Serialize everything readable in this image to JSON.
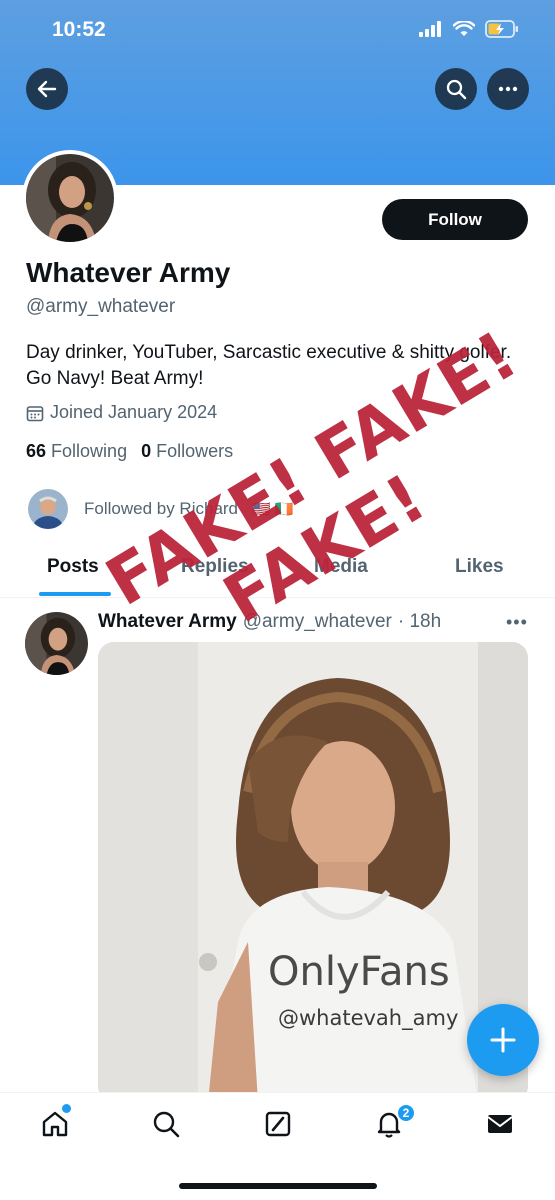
{
  "status_bar": {
    "time": "10:52"
  },
  "profile": {
    "name": "Whatever Army",
    "handle": "@army_whatever",
    "bio": "Day drinker, YouTuber, Sarcastic executive & shitty golfer. Go Navy! Beat Army!",
    "joined": "Joined January 2024",
    "following_count": "66",
    "following_label": "Following",
    "followers_count": "0",
    "followers_label": "Followers",
    "followed_by": "Followed by Richard",
    "followed_by_flags": "🇺🇸 🇮🇪",
    "follow_button": "Follow"
  },
  "tabs": [
    {
      "label": "Posts",
      "active": true
    },
    {
      "label": "Replies",
      "active": false
    },
    {
      "label": "Media",
      "active": false
    },
    {
      "label": "Likes",
      "active": false
    }
  ],
  "post": {
    "author_name": "Whatever Army",
    "author_handle": "@army_whatever",
    "time": "· 18h",
    "more": "•••",
    "shirt_text_line1": "OnlyFans",
    "shirt_text_line2": "@whatevah_amy"
  },
  "overlay": {
    "line1": "FAKE! FAKE!",
    "line2": "FAKE!"
  },
  "nav": {
    "notifications_badge": "2",
    "items": [
      "home-icon",
      "search-icon",
      "grok-icon",
      "bell-icon",
      "mail-icon"
    ]
  },
  "colors": {
    "accent": "#1d9bf0",
    "banner": "#4a9be6",
    "stamp": "#ba2338"
  }
}
